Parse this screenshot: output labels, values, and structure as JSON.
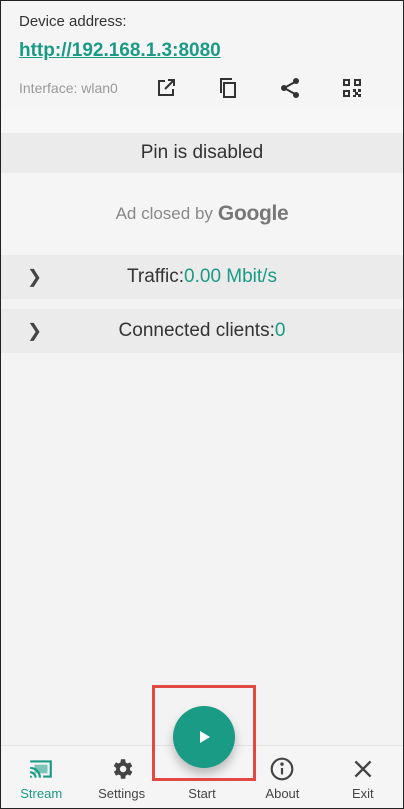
{
  "header": {
    "device_label": "Device address:",
    "device_url": "http://192.168.1.3:8080",
    "interface": "Interface: wlan0",
    "icons": [
      "open-external-icon",
      "copy-icon",
      "share-icon",
      "qr-code-icon"
    ]
  },
  "pin": {
    "text": "Pin is disabled"
  },
  "ad": {
    "prefix": "Ad closed by",
    "brand": "Google"
  },
  "traffic": {
    "label": "Traffic: ",
    "value": "0.00 Mbit/s"
  },
  "clients": {
    "label": "Connected clients: ",
    "value": "0"
  },
  "fab": {
    "icon": "play-icon"
  },
  "nav": {
    "stream": "Stream",
    "settings": "Settings",
    "start": "Start",
    "about": "About",
    "exit": "Exit"
  },
  "colors": {
    "accent": "#1a9b85",
    "highlight": "#e04a42"
  }
}
